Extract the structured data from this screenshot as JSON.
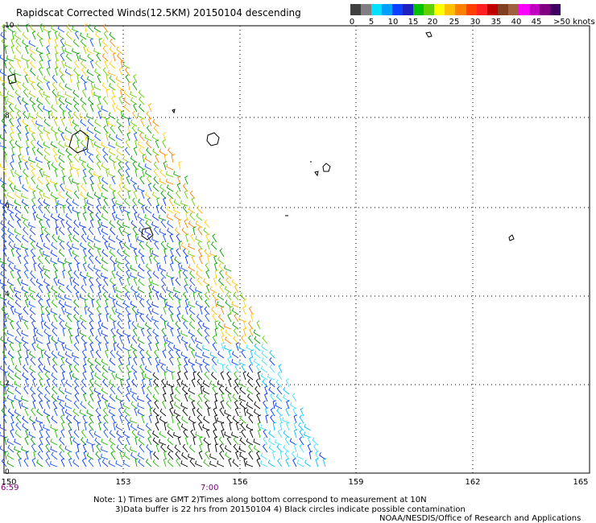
{
  "title": "Rapidscat Corrected Winds(12.5KM) 20150104 descending",
  "legend": {
    "colors": [
      "#404040",
      "#808080",
      "#00e0ff",
      "#00a0ff",
      "#1040ff",
      "#2020c0",
      "#00c000",
      "#60d000",
      "#ffff00",
      "#ffc000",
      "#ff8000",
      "#ff4000",
      "#ff2020",
      "#c00000",
      "#804020",
      "#a06040",
      "#ff00ff",
      "#c000c0",
      "#800080",
      "#400060"
    ],
    "ticks": [
      "0",
      "5",
      "10",
      "15",
      "20",
      "25",
      "30",
      "35",
      "40",
      "45",
      ">50 knots"
    ]
  },
  "axes": {
    "lat_ticks": [
      "10",
      "8",
      "6",
      "4",
      "2",
      "0"
    ],
    "lon_ticks": [
      "150",
      "153",
      "156",
      "159",
      "162",
      "165"
    ]
  },
  "times": {
    "left": "6:59",
    "center": "7:00"
  },
  "notes": {
    "line1": "Note: 1) Times are GMT 2)Times along bottom correspond to measurement at 10N",
    "line2": "3)Data buffer is 22 hrs from 20150104 4) Black circles indicate possible contamination",
    "credit": "NOAA/NESDIS/Office of Research and Applications"
  }
}
